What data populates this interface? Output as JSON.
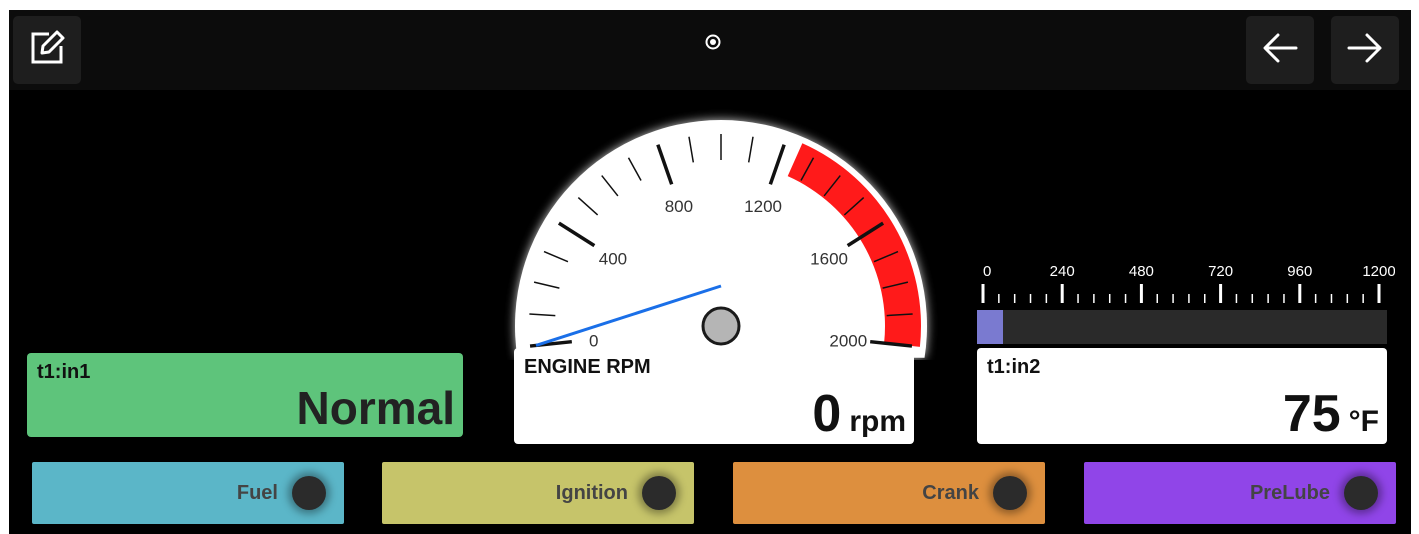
{
  "topbar": {
    "edit_icon": "edit-icon",
    "back_icon": "arrow-left-icon",
    "forward_icon": "arrow-right-icon",
    "status_icon": "status-dot-icon"
  },
  "gauge": {
    "title": "ENGINE RPM",
    "value": "0",
    "unit": "rpm",
    "min": 0,
    "max": 2000,
    "redline_start": 1250,
    "current": 0,
    "tick_labels": [
      "0",
      "400",
      "800",
      "1200",
      "1600",
      "2000"
    ],
    "redline_color": "#ff1a1a",
    "needle_color": "#1a6fe8"
  },
  "panel_left": {
    "label": "t1:in1",
    "state": "Normal",
    "color": "#5ec47b"
  },
  "panel_right": {
    "label": "t1:in2",
    "value": "75",
    "unit": "°F"
  },
  "bar_scale": {
    "tick_labels": [
      "0",
      "240",
      "480",
      "720",
      "960",
      "1200"
    ],
    "fill_fraction": 0.0625,
    "fill_color": "#7a7ad0"
  },
  "buttons": [
    {
      "label": "Fuel",
      "color": "#5bb6c8"
    },
    {
      "label": "Ignition",
      "color": "#c6c46a"
    },
    {
      "label": "Crank",
      "color": "#dd8f3e"
    },
    {
      "label": "PreLube",
      "color": "#9045e8"
    }
  ]
}
